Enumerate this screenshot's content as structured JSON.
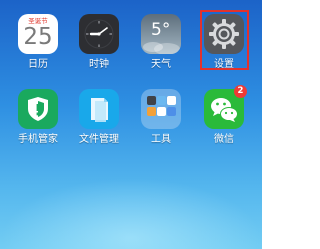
{
  "apps": {
    "calendar": {
      "label": "日历",
      "header": "圣诞节",
      "day": "25",
      "icon": "calendar-icon"
    },
    "clock": {
      "label": "时钟",
      "icon": "clock-icon"
    },
    "weather": {
      "label": "天气",
      "temp": "5°",
      "icon": "weather-icon"
    },
    "settings": {
      "label": "设置",
      "icon": "gear-icon",
      "highlighted": true
    },
    "phone_manager": {
      "label": "手机管家",
      "icon": "shield-icon"
    },
    "file_manager": {
      "label": "文件管理",
      "icon": "folder-icon"
    },
    "tools": {
      "label": "工具",
      "icon": "tools-folder-icon"
    },
    "wechat": {
      "label": "微信",
      "icon": "wechat-icon",
      "badge": "2"
    }
  },
  "colors": {
    "highlight_border": "#e2322d",
    "badge": "#f03a35",
    "wallpaper_top": "#1c63c8",
    "wallpaper_bottom": "#73cdf3"
  }
}
